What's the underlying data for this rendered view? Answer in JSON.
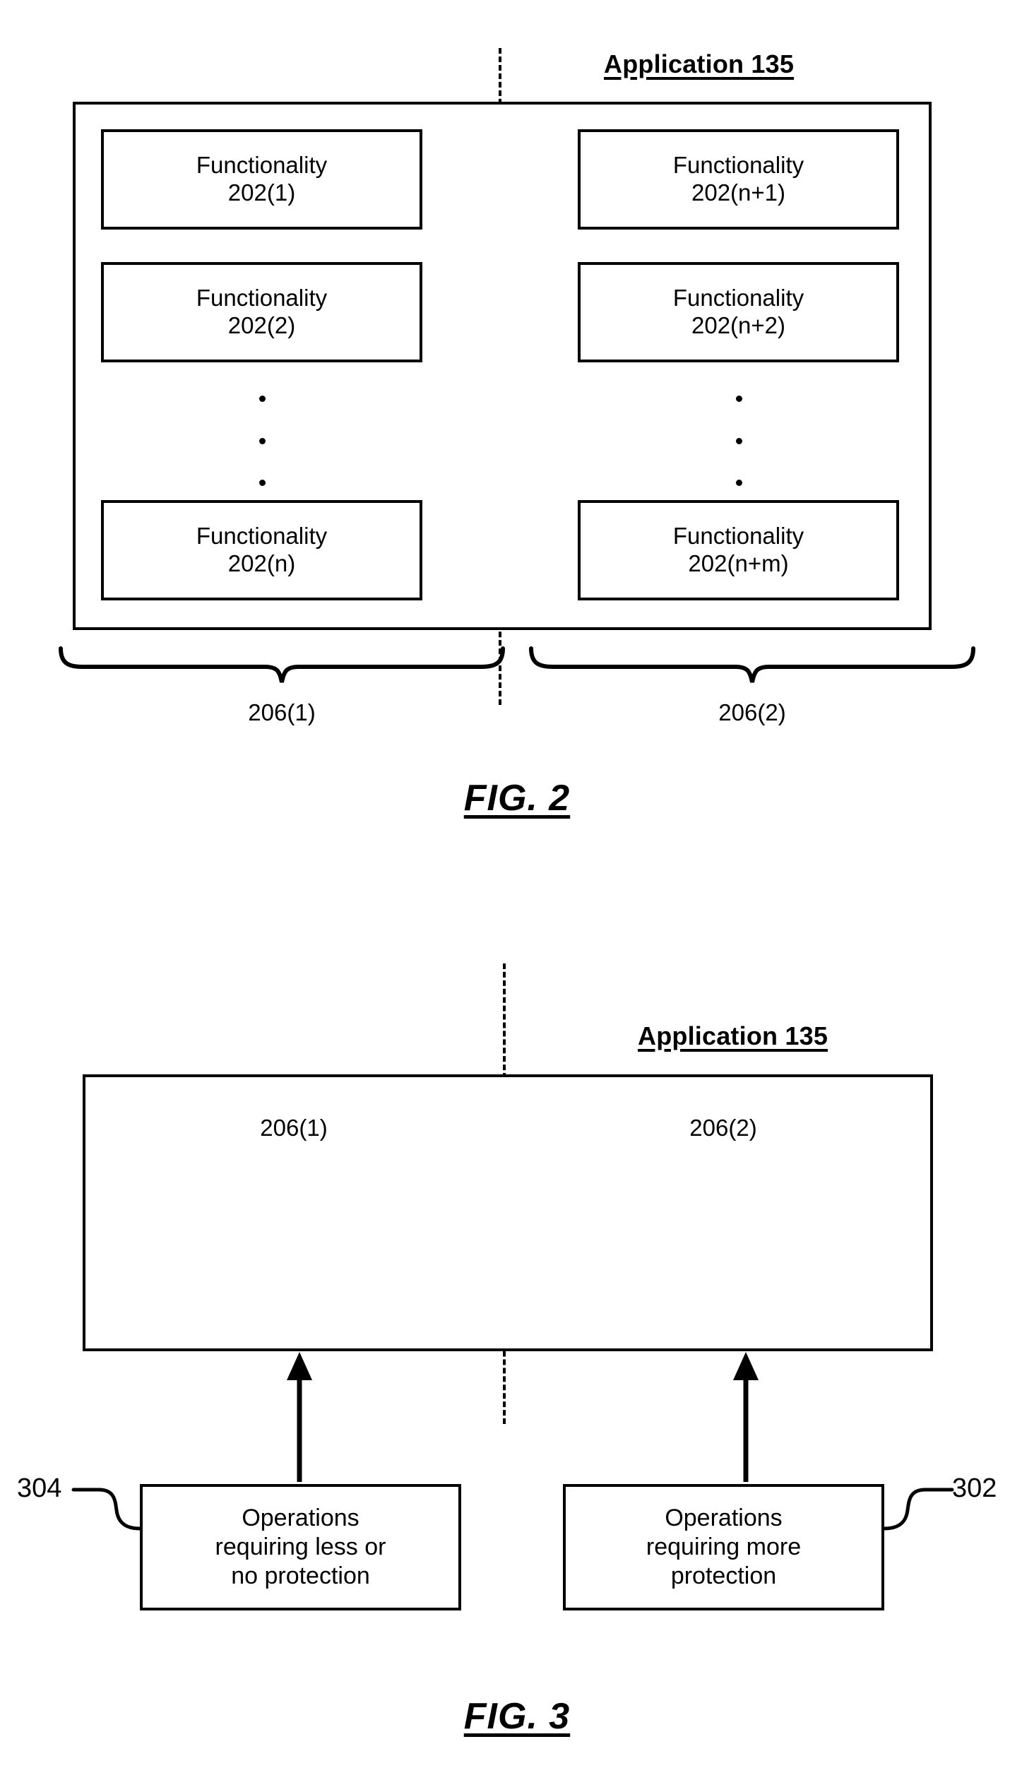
{
  "figure2": {
    "title": "Application 135",
    "left_column": {
      "boxes": [
        {
          "line1": "Functionality",
          "line2": "202(1)"
        },
        {
          "line1": "Functionality",
          "line2": "202(2)"
        },
        {
          "line1": "Functionality",
          "line2": "202(n)"
        }
      ],
      "brace_label": "206(1)"
    },
    "right_column": {
      "boxes": [
        {
          "line1": "Functionality",
          "line2": "202(n+1)"
        },
        {
          "line1": "Functionality",
          "line2": "202(n+2)"
        },
        {
          "line1": "Functionality",
          "line2": "202(n+m)"
        }
      ],
      "brace_label": "206(2)"
    },
    "caption": "FIG. 2"
  },
  "figure3": {
    "title": "Application 135",
    "left_segment_label": "206(1)",
    "right_segment_label": "206(2)",
    "left_box": {
      "line1": "Operations",
      "line2": "requiring less or",
      "line3": "no protection",
      "ref": "304"
    },
    "right_box": {
      "line1": "Operations",
      "line2": "requiring more",
      "line3": "protection",
      "ref": "302"
    },
    "caption": "FIG. 3"
  },
  "colors": {
    "ink": "#000000",
    "paper": "#ffffff"
  }
}
